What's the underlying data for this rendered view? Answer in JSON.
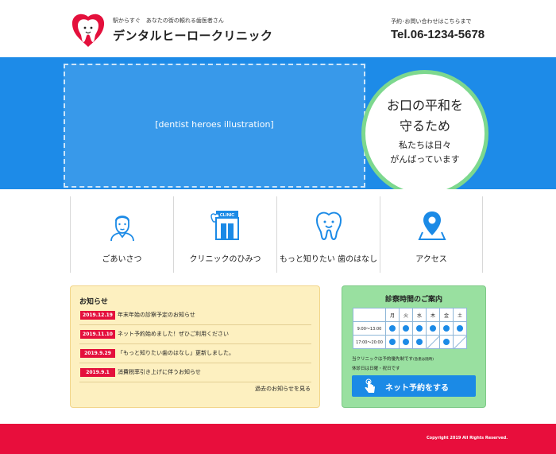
{
  "header": {
    "tagline": "駅からすぐ　あなたの街の頼れる歯医者さん",
    "clinic_name": "デンタルヒーロークリニック",
    "contact_label": "予約･お問い合わせはこちらまで",
    "tel": "Tel.06-1234-5678"
  },
  "hero": {
    "illustration_alt": "[dentist heroes illustration]",
    "line1": "お口の平和を",
    "line2": "守るため",
    "line3": "私たちは日々",
    "line4": "がんばっています",
    "background_color": "#1d8be8",
    "circle_border_color": "#7dd88e"
  },
  "nav": {
    "items": [
      {
        "label": "ごあいさつ",
        "icon": "doctor-portrait-icon"
      },
      {
        "label": "クリニックのひみつ",
        "icon": "clinic-building-icon"
      },
      {
        "label": "もっと知りたい 歯のはなし",
        "icon": "tooth-icon"
      },
      {
        "label": "アクセス",
        "icon": "map-pin-icon"
      }
    ],
    "icon_color": "#1b8ae6"
  },
  "news": {
    "title": "お知らせ",
    "items": [
      {
        "date": "2019.12.19",
        "text": "年末年始の診察予定のお知らせ"
      },
      {
        "date": "2019.11.10",
        "text": "ネット予約始めました！ぜひご利用ください"
      },
      {
        "date": "2019.9.29",
        "text": "「もっと知りたい歯のはなし」更新しました。"
      },
      {
        "date": "2019.9.1",
        "text": "消費税率引き上げに伴うお知らせ"
      }
    ],
    "more_label": "過去のお知らせを見る",
    "date_badge_color": "#e4103c"
  },
  "hours": {
    "title": "診察時間のご案内",
    "days": [
      "月",
      "火",
      "水",
      "木",
      "金",
      "土"
    ],
    "rows": [
      {
        "time": "9:00～13:00",
        "slots": [
          "open",
          "open",
          "open",
          "open",
          "open",
          "open"
        ]
      },
      {
        "time": "17:00～20:00",
        "slots": [
          "open",
          "open",
          "open",
          "closed",
          "open",
          "closed"
        ]
      }
    ],
    "note_main": "当クリニックは予約優先制です",
    "note_small": "(急患は随時)",
    "note_closed": "休診日は日曜・祝日です",
    "reserve_label": "ネット予約をする"
  },
  "footer": {
    "copyright": "Copyright 2019 All Rights Reserved.",
    "background_color": "#e80e3c"
  }
}
